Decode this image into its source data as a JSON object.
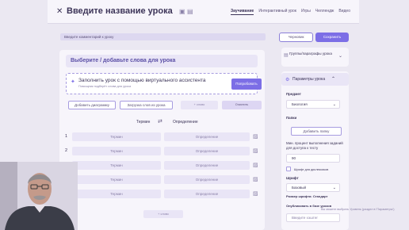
{
  "topbar": {
    "close_icon": "close-icon",
    "title": "Введите название урока",
    "icons": [
      "image-icon",
      "picture-icon"
    ],
    "tabs": [
      {
        "label": "Заучивание",
        "active": true
      },
      {
        "label": "Интерактивный урок",
        "active": false
      },
      {
        "label": "Игры",
        "active": false
      },
      {
        "label": "Челлендж",
        "active": false
      },
      {
        "label": "Видео",
        "active": false
      }
    ]
  },
  "comment_placeholder": "Введите комментарий к уроку",
  "actions": {
    "draft": "Черновик",
    "save": "Сохранить"
  },
  "words": {
    "heading": "Выберите / добавьте слова для урока",
    "ai": {
      "title": "Заполнить урок с помощью виртуального ассистента",
      "subtitle": "Помощник подберёт слова для урока",
      "button": "Попробовать"
    },
    "tools": {
      "add_diagram": "Добавить диаграмму",
      "upload": "Загрузка слов из урока",
      "third": "+ слово",
      "fourth": "Очистить"
    },
    "columns": {
      "term": "Термин",
      "definition": "Определение"
    },
    "rows": [
      {
        "num": "1",
        "term": "Термин",
        "definition": "Определение"
      },
      {
        "num": "2",
        "term": "Термин",
        "definition": "Определение"
      },
      {
        "num": "3",
        "term": "Термин",
        "definition": "Определение"
      },
      {
        "num": "4",
        "term": "Термин",
        "definition": "Определение"
      },
      {
        "num": "5",
        "term": "Термин",
        "definition": "Определение"
      }
    ],
    "add_row": "+ слово"
  },
  "sidebar": {
    "groups_label": "Группы/параграфы урока",
    "params_label": "Параметры урока",
    "subject_label": "Предмет",
    "subject_value": "Биология",
    "folders_label": "Папки",
    "add_folder": "Добавить папку",
    "min_percent_label": "Мин. процент выполнения заданий для доступа к тесту",
    "min_percent_value": "90",
    "dyslexia_label": "Шрифт для дислексиков",
    "font_label": "Шрифт",
    "font_value": "Базовый",
    "font_size_label": "Размер шрифта: Стандарт",
    "publish_label": "Опубликовать в базе уроков",
    "hashtag_placeholder": "Введите хэштег",
    "footnote": "Вы можете выбрать Уровень (раздел в 'Параметры')"
  }
}
